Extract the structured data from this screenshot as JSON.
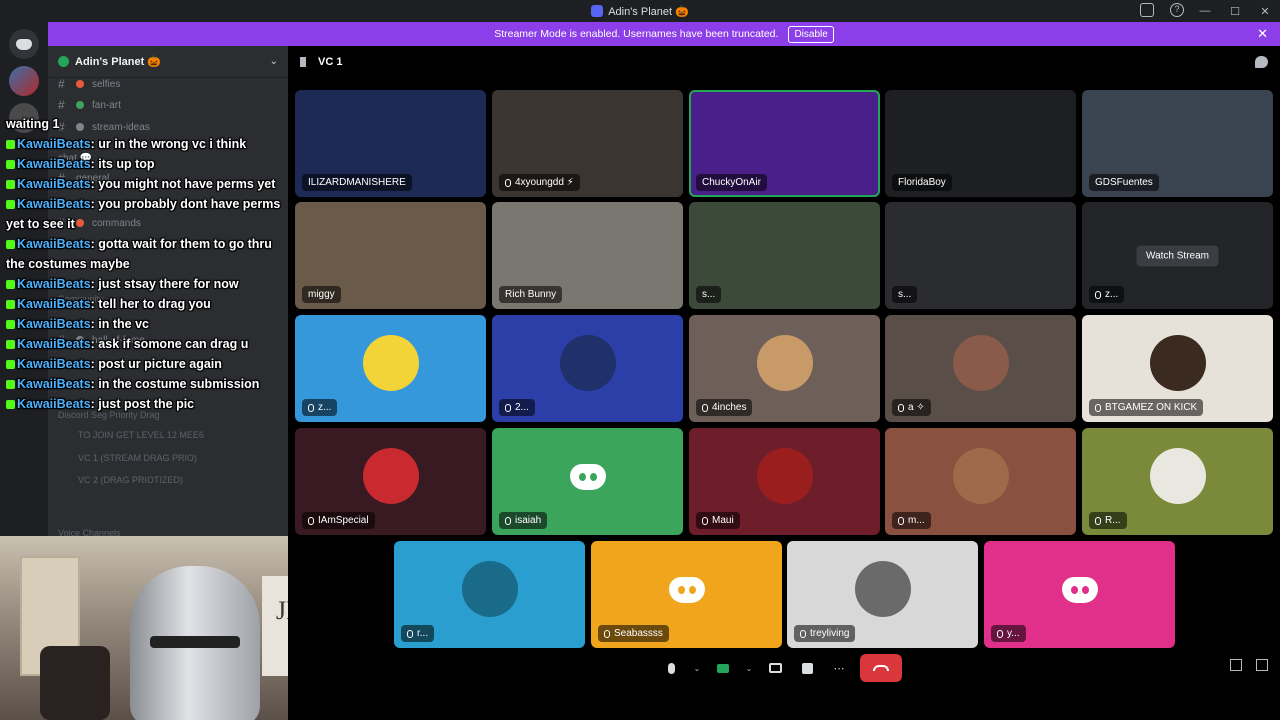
{
  "window": {
    "title": "Adin's Planet 🎃"
  },
  "banner": {
    "text": "Streamer Mode is enabled. Usernames have been truncated.",
    "disable_label": "Disable"
  },
  "sidebar": {
    "server_name": "Adin's Planet 🎃",
    "channels": [
      {
        "label": "selfies"
      },
      {
        "label": "fan-art"
      },
      {
        "label": "stream-ideas"
      },
      {
        "label": "chat 💬"
      },
      {
        "label": "general"
      },
      {
        "label": "commands"
      },
      {
        "label": "hall-of-fame"
      }
    ],
    "categories": [
      "Community",
      "Discord Seg Priority Drag"
    ],
    "voice_items": [
      "TO JOIN GET LEVEL 12 MEE6",
      "VC 1 (STREAM DRAG PRIO)",
      "VC 2 (DRAG PRIOTIZED)"
    ],
    "voice_channels_label": "Voice Channels"
  },
  "chat_overlay": [
    {
      "user": "",
      "text": "waiting 1"
    },
    {
      "user": "KawaiiBeats",
      "text": ": ur in the wrong vc i think"
    },
    {
      "user": "KawaiiBeats",
      "text": ": its up top"
    },
    {
      "user": "KawaiiBeats",
      "text": ": you might not have perms yet"
    },
    {
      "user": "KawaiiBeats",
      "text": ": you probably dont have perms yet to see it"
    },
    {
      "user": "KawaiiBeats",
      "text": ": gotta wait for them to go thru the costumes maybe"
    },
    {
      "user": "KawaiiBeats",
      "text": ": just stsay there for now"
    },
    {
      "user": "KawaiiBeats",
      "text": ": tell her to drag you"
    },
    {
      "user": "KawaiiBeats",
      "text": ": in the vc"
    },
    {
      "user": "KawaiiBeats",
      "text": ": ask if somone can drag u"
    },
    {
      "user": "KawaiiBeats",
      "text": ": post ur picture again"
    },
    {
      "user": "KawaiiBeats",
      "text": ": in the costume submission"
    },
    {
      "user": "KawaiiBeats",
      "text": ": just post the pic"
    }
  ],
  "webcam": {
    "flag_text": "JES"
  },
  "voice": {
    "channel_name": "VC 1",
    "tiles": [
      {
        "name": "ILIZARDMANISHERE",
        "bg": "#1d2a55",
        "kind": "video"
      },
      {
        "name": "4xyoungdd ⚡",
        "bg": "#3a3530",
        "kind": "video"
      },
      {
        "name": "ChuckyOnAir",
        "bg": "#4a1f8a",
        "kind": "video",
        "speaking": true
      },
      {
        "name": "FloridaBoy",
        "bg": "#1e1f22",
        "kind": "video"
      },
      {
        "name": "GDSFuentes",
        "bg": "#3a4450",
        "kind": "video"
      },
      {
        "name": "miggy",
        "bg": "#6a5a4a",
        "kind": "video"
      },
      {
        "name": "Rich Bunny",
        "bg": "#7a7670",
        "kind": "video"
      },
      {
        "name": "s...",
        "bg": "#3c4a3a",
        "kind": "video"
      },
      {
        "name": "s...",
        "bg": "#2a2c30",
        "kind": "video"
      },
      {
        "name": "z...",
        "bg": "#232428",
        "kind": "stream",
        "watch_label": "Watch Stream"
      },
      {
        "name": "z...",
        "bg": "#3498db",
        "kind": "avatar",
        "avatar_color": "#f2d338"
      },
      {
        "name": "2...",
        "bg": "#2c3fa8",
        "kind": "avatar",
        "avatar_color": "#20306a"
      },
      {
        "name": "4inches",
        "bg": "#6e5f59",
        "kind": "avatar",
        "avatar_color": "#c89a68"
      },
      {
        "name": "a ✧",
        "bg": "#5a4e48",
        "kind": "avatar",
        "avatar_color": "#8a5a4a"
      },
      {
        "name": "BTGAMEZ ON KICK",
        "bg": "#e6e2da",
        "kind": "avatar",
        "avatar_color": "#3a2a20"
      },
      {
        "name": "IAmSpecial",
        "bg": "#3a1a22",
        "kind": "avatar",
        "avatar_color": "#c82a30"
      },
      {
        "name": "isaiah",
        "bg": "#3ba55c",
        "kind": "discord"
      },
      {
        "name": "Maui",
        "bg": "#6e1e2a",
        "kind": "avatar",
        "avatar_color": "#9a1e1e"
      },
      {
        "name": "m...",
        "bg": "#8a5040",
        "kind": "avatar",
        "avatar_color": "#a06a4a"
      },
      {
        "name": "R...",
        "bg": "#7a8a3a",
        "kind": "avatar",
        "avatar_color": "#e8e8e0"
      },
      {
        "name": "r...",
        "bg": "#2a9fcf",
        "kind": "avatar",
        "avatar_color": "#1a6a8a"
      },
      {
        "name": "Seabassss",
        "bg": "#f0a51c",
        "kind": "discord"
      },
      {
        "name": "treyliving",
        "bg": "#d8d8d8",
        "kind": "avatar",
        "avatar_color": "#6a6a6a"
      },
      {
        "name": "y...",
        "bg": "#e0308a",
        "kind": "discord"
      }
    ]
  }
}
